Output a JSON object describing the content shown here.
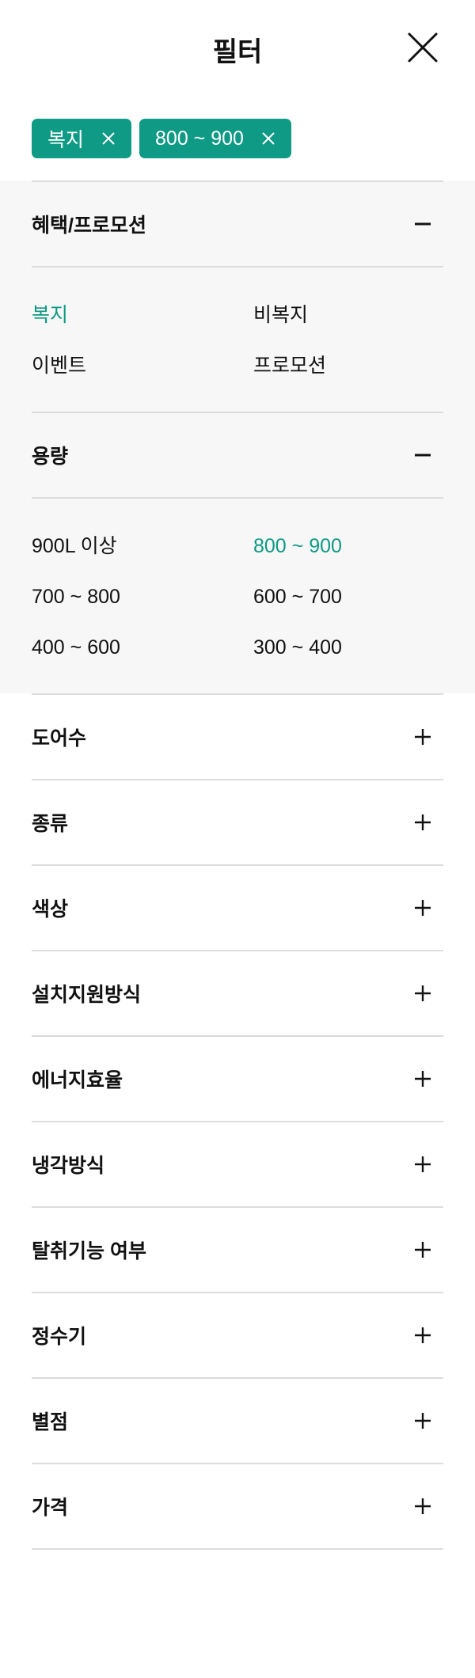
{
  "header": {
    "title": "필터"
  },
  "chips": [
    {
      "label": "복지"
    },
    {
      "label": "800 ~ 900"
    }
  ],
  "colors": {
    "accent": "#0e9a84"
  },
  "sections": [
    {
      "label": "혜택/프로모션",
      "open": true,
      "options": [
        {
          "label": "복지",
          "selected": true
        },
        {
          "label": "비복지",
          "selected": false
        },
        {
          "label": "이벤트",
          "selected": false
        },
        {
          "label": "프로모션",
          "selected": false
        }
      ]
    },
    {
      "label": "용량",
      "open": true,
      "options": [
        {
          "label": "900L 이상",
          "selected": false
        },
        {
          "label": "800 ~ 900",
          "selected": true
        },
        {
          "label": "700 ~ 800",
          "selected": false
        },
        {
          "label": "600 ~ 700",
          "selected": false
        },
        {
          "label": "400 ~ 600",
          "selected": false
        },
        {
          "label": "300 ~ 400",
          "selected": false
        }
      ]
    },
    {
      "label": "도어수",
      "open": false
    },
    {
      "label": "종류",
      "open": false
    },
    {
      "label": "색상",
      "open": false
    },
    {
      "label": "설치지원방식",
      "open": false
    },
    {
      "label": "에너지효율",
      "open": false
    },
    {
      "label": "냉각방식",
      "open": false
    },
    {
      "label": "탈취기능 여부",
      "open": false
    },
    {
      "label": "정수기",
      "open": false
    },
    {
      "label": "별점",
      "open": false
    },
    {
      "label": "가격",
      "open": false
    }
  ]
}
